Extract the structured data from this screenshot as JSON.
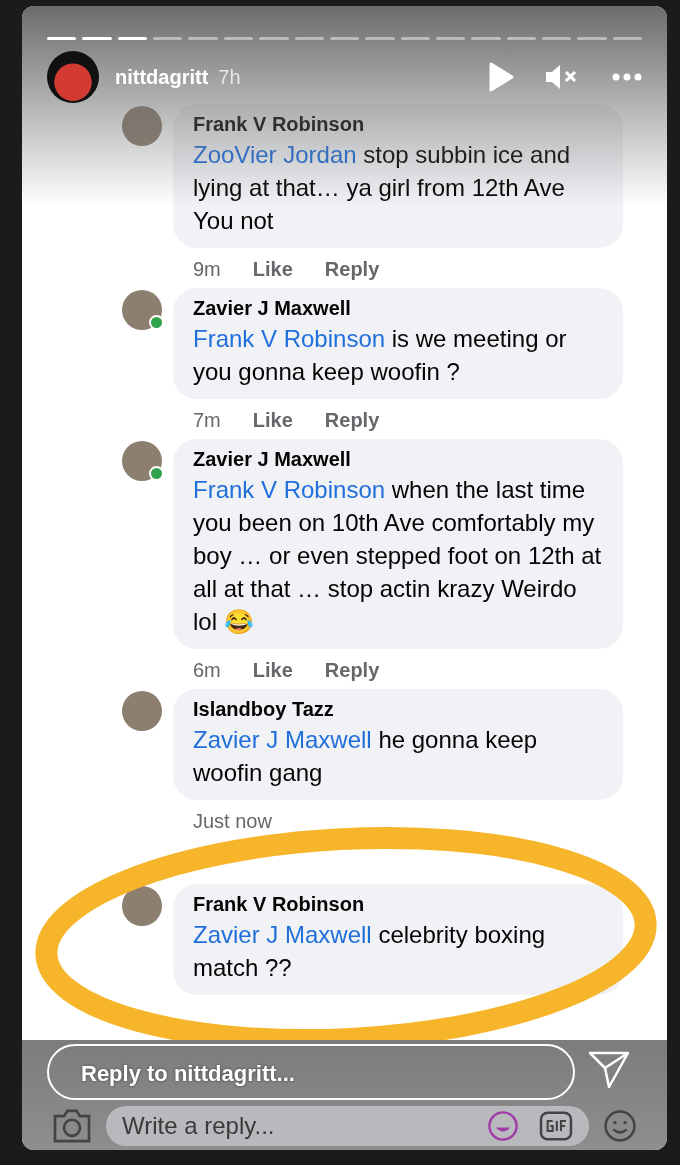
{
  "story": {
    "username": "nittdagritt",
    "time": "7h",
    "segments": [
      {
        "viewed": true
      },
      {
        "viewed": true
      },
      {
        "viewed": true
      },
      {
        "viewed": false
      },
      {
        "viewed": false
      },
      {
        "viewed": false
      },
      {
        "viewed": false
      },
      {
        "viewed": false
      },
      {
        "viewed": false
      },
      {
        "viewed": false
      },
      {
        "viewed": false
      },
      {
        "viewed": false
      },
      {
        "viewed": false
      },
      {
        "viewed": false
      },
      {
        "viewed": false
      },
      {
        "viewed": false
      },
      {
        "viewed": false
      }
    ]
  },
  "comments": [
    {
      "author": "Frank V Robinson",
      "mention": "ZooVier Jordan",
      "text": "stop subbin ice and lying at that… ya girl from 12th Ave You not",
      "time": "9m",
      "like": "Like",
      "reply": "Reply",
      "online": false
    },
    {
      "author": "Zavier J Maxwell",
      "mention": "Frank V Robinson",
      "text": "is we meeting or you gonna keep woofin ?",
      "time": "7m",
      "like": "Like",
      "reply": "Reply",
      "online": true
    },
    {
      "author": "Zavier J Maxwell",
      "mention": "Frank V Robinson",
      "text": "when the last time you been on 10th Ave comfortably my boy … or even stepped foot on 12th at all at that … stop actin krazy Weirdo lol 😂",
      "time": "6m",
      "like": "Like",
      "reply": "Reply",
      "online": true
    },
    {
      "author": "Islandboy Tazz",
      "mention": "Zavier J Maxwell",
      "text": "he gonna keep woofin gang",
      "time": "Just now",
      "online": false
    },
    {
      "author": "Frank V Robinson",
      "mention": "Zavier J Maxwell",
      "text": "celebrity boxing match ??",
      "online": false,
      "highlighted": true
    }
  ],
  "composer": {
    "placeholder": "Write a reply..."
  },
  "story_reply": {
    "placeholder": "Reply to nittdagritt..."
  }
}
